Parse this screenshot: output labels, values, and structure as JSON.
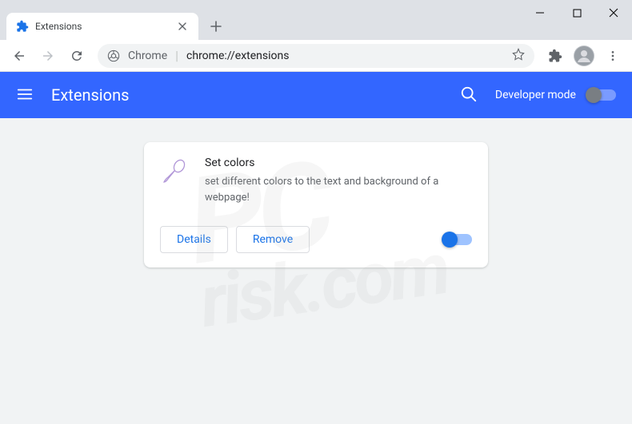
{
  "tab": {
    "title": "Extensions"
  },
  "omnibox": {
    "scheme_label": "Chrome",
    "url": "chrome://extensions"
  },
  "header": {
    "title": "Extensions",
    "dev_mode_label": "Developer mode",
    "dev_mode_on": false
  },
  "extension": {
    "name": "Set colors",
    "description": "set different colors to the text and background of a webpage!",
    "details_label": "Details",
    "remove_label": "Remove",
    "enabled": true
  },
  "watermark": {
    "line1": "PC",
    "line2": "risk.com"
  }
}
